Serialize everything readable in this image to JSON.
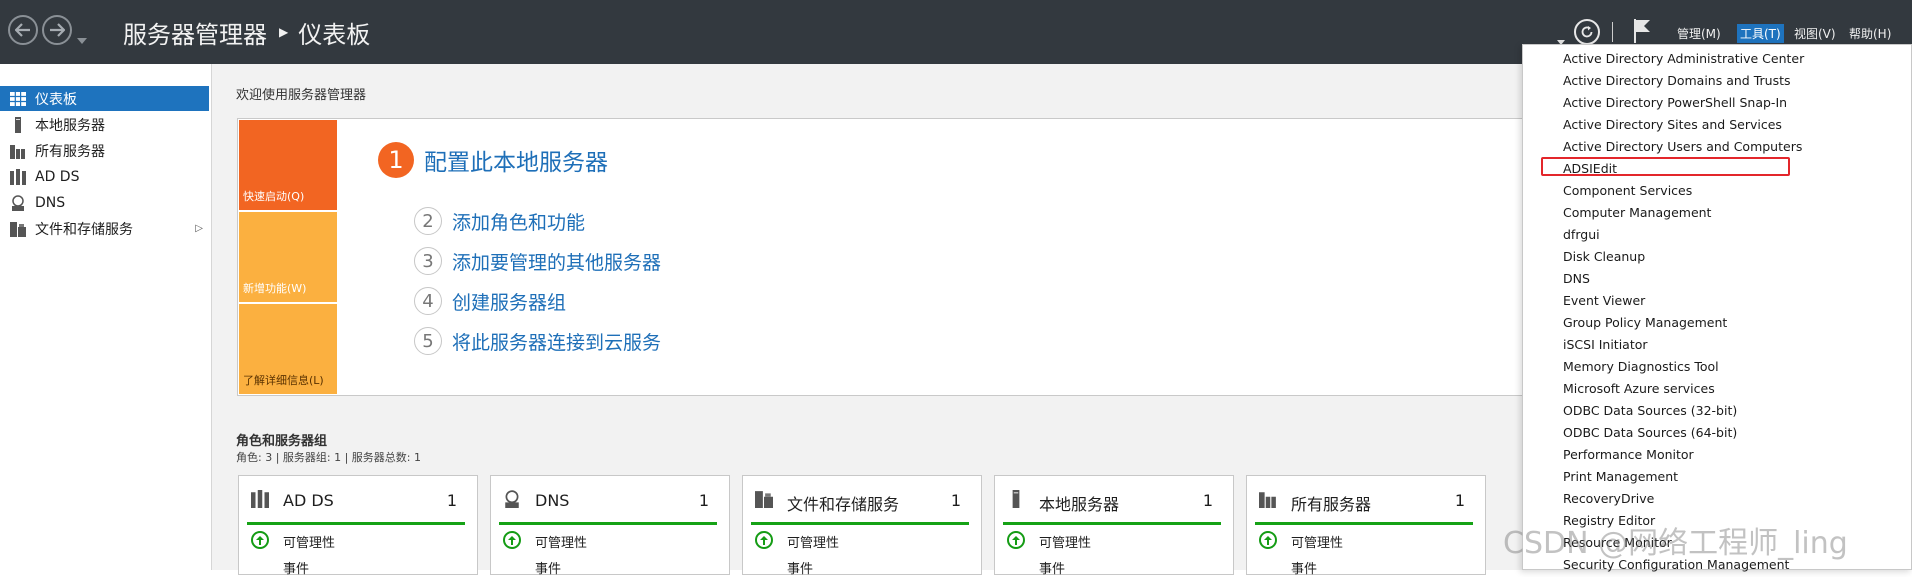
{
  "titlebar": {
    "app_name": "服务器管理器",
    "page_name": "仪表板",
    "menus": [
      {
        "label": "管理(M)",
        "active": false
      },
      {
        "label": "工具(T)",
        "active": true
      },
      {
        "label": "视图(V)",
        "active": false
      },
      {
        "label": "帮助(H)",
        "active": false
      }
    ]
  },
  "sidebar": {
    "items": [
      {
        "label": "仪表板",
        "icon": "dashboard-icon",
        "active": true
      },
      {
        "label": "本地服务器",
        "icon": "server-icon",
        "active": false
      },
      {
        "label": "所有服务器",
        "icon": "servers-icon",
        "active": false
      },
      {
        "label": "AD DS",
        "icon": "adds-icon",
        "active": false
      },
      {
        "label": "DNS",
        "icon": "dns-icon",
        "active": false
      },
      {
        "label": "文件和存储服务",
        "icon": "storage-icon",
        "active": false
      }
    ]
  },
  "welcome": {
    "label": "欢迎使用服务器管理器",
    "tiles": [
      "快速启动(Q)",
      "新增功能(W)",
      "了解详细信息(L)"
    ],
    "main_step": {
      "num": "1",
      "text": "配置此本地服务器"
    },
    "steps": [
      {
        "num": "2",
        "text": "添加角色和功能"
      },
      {
        "num": "3",
        "text": "添加要管理的其他服务器"
      },
      {
        "num": "4",
        "text": "创建服务器组"
      },
      {
        "num": "5",
        "text": "将此服务器连接到云服务"
      }
    ]
  },
  "roles": {
    "title": "角色和服务器组",
    "subtitle": "角色: 3 | 服务器组: 1 | 服务器总数: 1",
    "cards": [
      {
        "title": "AD DS",
        "count": "1",
        "status": "可管理性",
        "event": "事件",
        "icon": "adds-icon"
      },
      {
        "title": "DNS",
        "count": "1",
        "status": "可管理性",
        "event": "事件",
        "icon": "dns-icon"
      },
      {
        "title": "文件和存储服务",
        "count": "1",
        "status": "可管理性",
        "event": "事件",
        "icon": "storage-icon"
      },
      {
        "title": "本地服务器",
        "count": "1",
        "status": "可管理性",
        "event": "事件",
        "icon": "server-icon"
      },
      {
        "title": "所有服务器",
        "count": "1",
        "status": "可管理性",
        "event": "事件",
        "icon": "servers-icon"
      }
    ]
  },
  "tools_menu": {
    "items": [
      "Active Directory Administrative Center",
      "Active Directory Domains and Trusts",
      "Active Directory PowerShell Snap-In",
      "Active Directory Sites and Services",
      "Active Directory Users and Computers",
      "ADSIEdit",
      "Component Services",
      "Computer Management",
      "dfrgui",
      "Disk Cleanup",
      "DNS",
      "Event Viewer",
      "Group Policy Management",
      "iSCSI Initiator",
      "Memory Diagnostics Tool",
      "Microsoft Azure services",
      "ODBC Data Sources (32-bit)",
      "ODBC Data Sources (64-bit)",
      "Performance Monitor",
      "Print Management",
      "RecoveryDrive",
      "Registry Editor",
      "Resource Monitor",
      "Security Configuration Management"
    ],
    "highlighted": "ADSIEdit"
  },
  "watermark": "CSDN @网络工程师_ling",
  "colors": {
    "titlebar": "#33393f",
    "accent": "#1e73be",
    "quick_start": "#f26522",
    "tile_secondary": "#fbb040",
    "link": "#1e6fb8",
    "ok_green": "#16a216",
    "highlight_red": "#e3262b"
  }
}
